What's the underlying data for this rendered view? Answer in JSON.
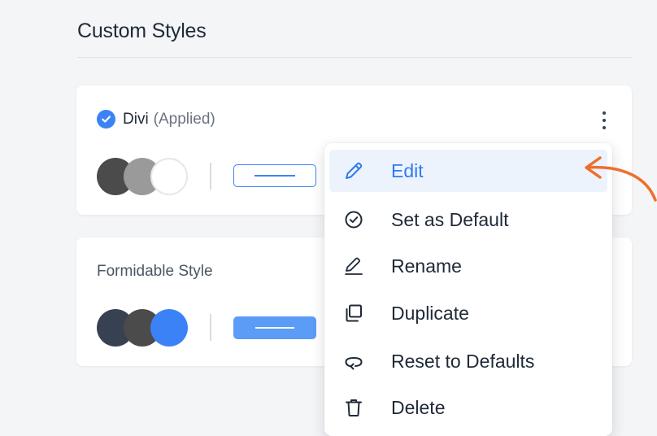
{
  "section": {
    "title": "Custom Styles"
  },
  "styles": [
    {
      "name": "Divi",
      "status": "(Applied)",
      "swatches": [
        "#4b4b4b",
        "#9a9a9a",
        "#ffffff"
      ],
      "button_preview": "outline"
    },
    {
      "name": "Formidable Style",
      "swatches": [
        "#374151",
        "#4b4b4b",
        "#3b82f6"
      ],
      "button_preview": "solid"
    }
  ],
  "menu": {
    "items": [
      {
        "label": "Edit",
        "icon": "pencil-icon",
        "active": true
      },
      {
        "label": "Set as Default",
        "icon": "check-circle-icon"
      },
      {
        "label": "Rename",
        "icon": "pen-underline-icon"
      },
      {
        "label": "Duplicate",
        "icon": "copy-icon"
      },
      {
        "label": "Reset to Defaults",
        "icon": "reset-icon"
      },
      {
        "label": "Delete",
        "icon": "trash-icon"
      }
    ]
  },
  "colors": {
    "accent": "#3b82f6",
    "active_text": "#2f7bf0",
    "active_bg": "#edf3fc",
    "annotation_arrow": "#ee6f2d"
  }
}
